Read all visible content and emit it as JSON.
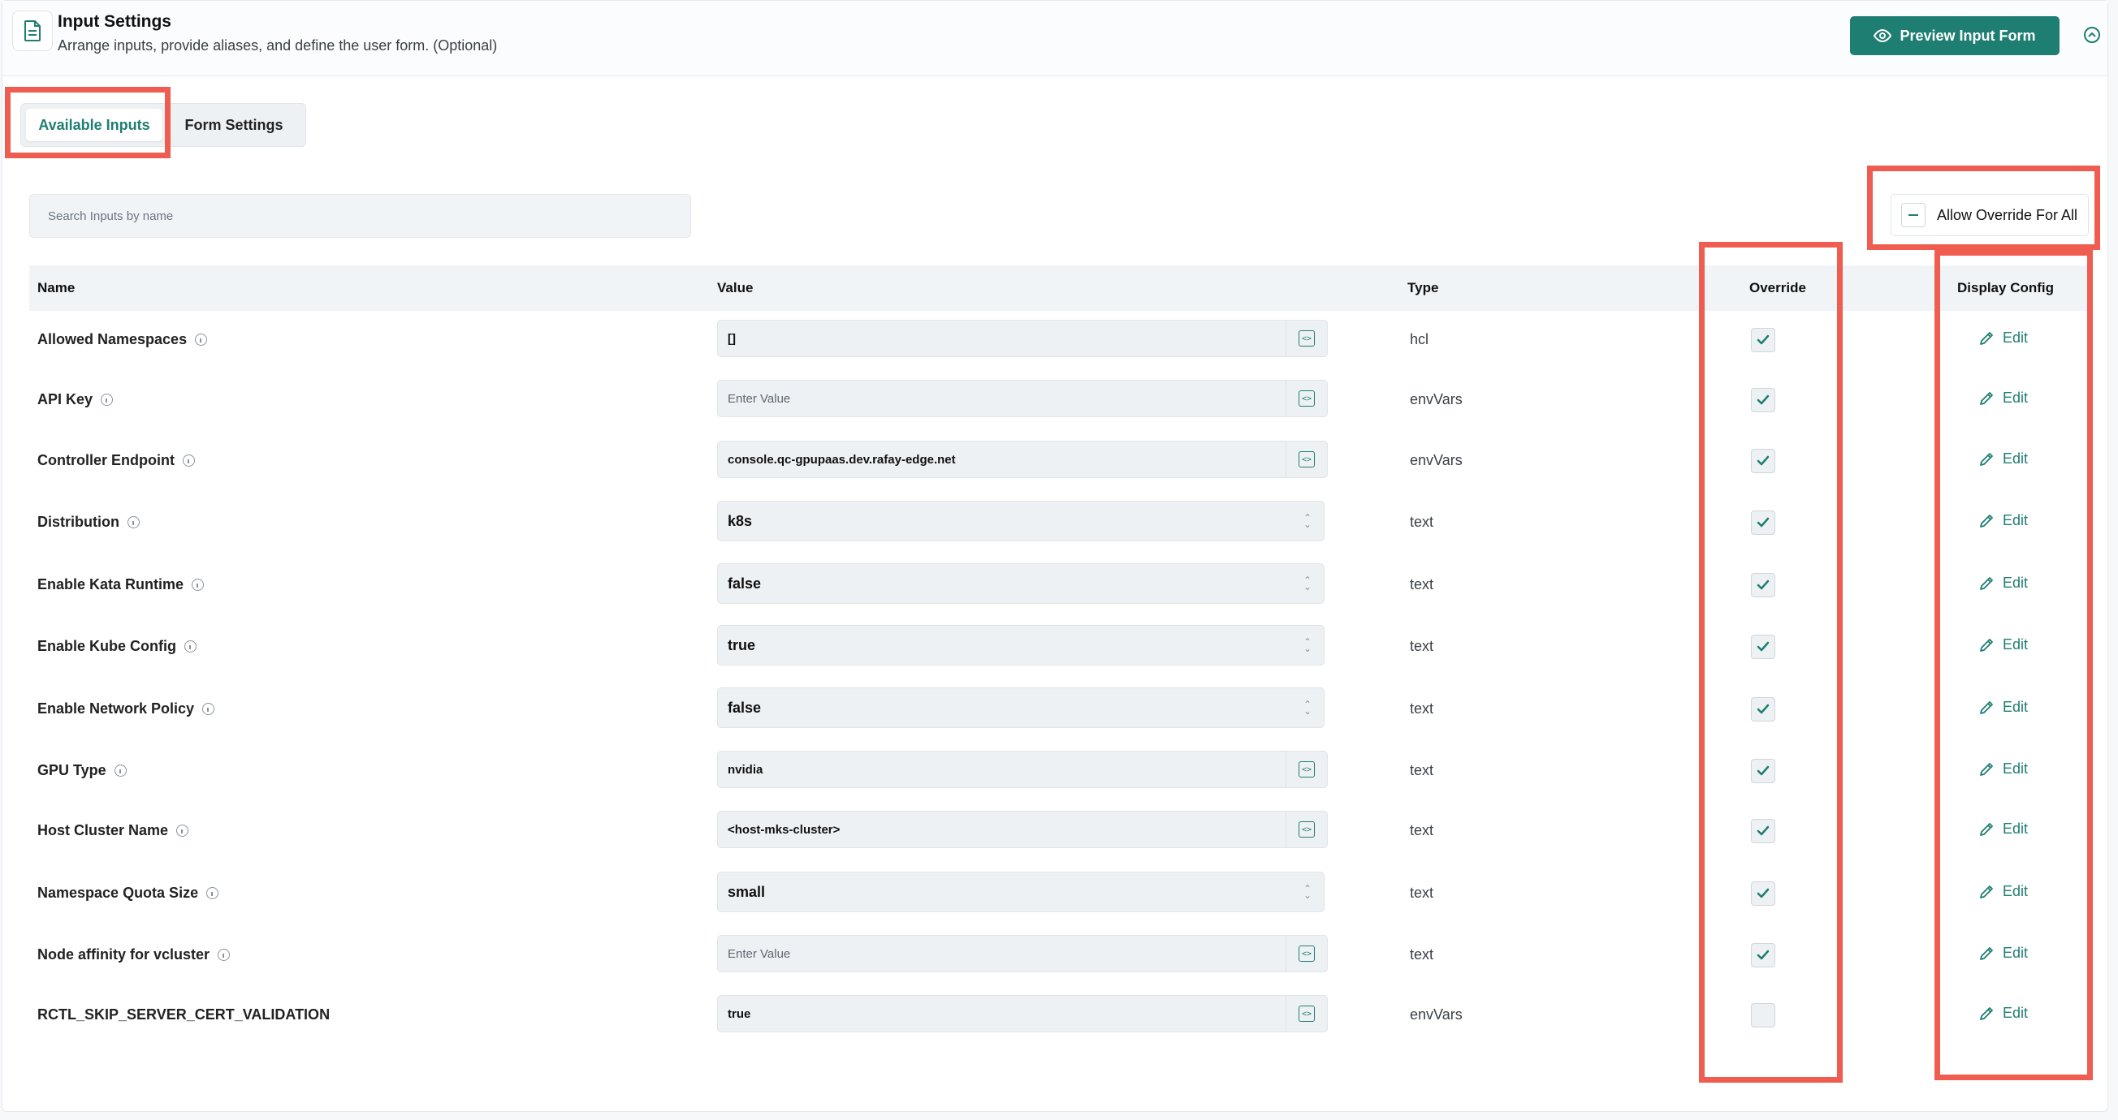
{
  "header": {
    "title": "Input Settings",
    "subtitle": "Arrange inputs, provide aliases, and define the user form. (Optional)",
    "preview_label": "Preview Input Form"
  },
  "tabs": [
    {
      "label": "Available Inputs",
      "active": true
    },
    {
      "label": "Form Settings",
      "active": false
    }
  ],
  "search": {
    "placeholder": "Search Inputs by name"
  },
  "override_all_label": "Allow Override For All",
  "table": {
    "headers": {
      "name": "Name",
      "value": "Value",
      "type": "Type",
      "override": "Override",
      "display": "Display Config"
    },
    "edit_label": "Edit",
    "rows": [
      {
        "name": "Allowed Namespaces",
        "info": true,
        "value": "[]",
        "placeholder": false,
        "control": "code",
        "type": "hcl",
        "override": true
      },
      {
        "name": "API Key",
        "info": true,
        "value": "Enter Value",
        "placeholder": true,
        "control": "code",
        "type": "envVars",
        "override": true
      },
      {
        "name": "Controller Endpoint",
        "info": true,
        "value": "console.qc-gpupaas.dev.rafay-edge.net",
        "placeholder": false,
        "control": "code",
        "type": "envVars",
        "override": true
      },
      {
        "name": "Distribution",
        "info": true,
        "value": "k8s",
        "placeholder": false,
        "control": "select",
        "type": "text",
        "override": true
      },
      {
        "name": "Enable Kata Runtime",
        "info": true,
        "value": "false",
        "placeholder": false,
        "control": "select",
        "type": "text",
        "override": true
      },
      {
        "name": "Enable Kube Config",
        "info": true,
        "value": "true",
        "placeholder": false,
        "control": "select",
        "type": "text",
        "override": true
      },
      {
        "name": "Enable Network Policy",
        "info": true,
        "value": "false",
        "placeholder": false,
        "control": "select",
        "type": "text",
        "override": true
      },
      {
        "name": "GPU Type",
        "info": true,
        "value": "nvidia",
        "placeholder": false,
        "control": "code",
        "type": "text",
        "override": true
      },
      {
        "name": "Host Cluster Name",
        "info": true,
        "value": "<host-mks-cluster>",
        "placeholder": false,
        "control": "code",
        "type": "text",
        "override": true
      },
      {
        "name": "Namespace Quota Size",
        "info": true,
        "value": "small",
        "placeholder": false,
        "control": "select",
        "type": "text",
        "override": true
      },
      {
        "name": "Node affinity for vcluster",
        "info": true,
        "value": "Enter Value",
        "placeholder": true,
        "control": "code",
        "type": "text",
        "override": true
      },
      {
        "name": "RCTL_SKIP_SERVER_CERT_VALIDATION",
        "info": false,
        "value": "true",
        "placeholder": false,
        "control": "code",
        "type": "envVars",
        "override": false
      }
    ]
  },
  "colors": {
    "accent": "#1e7e72",
    "highlight": "#ee5d50"
  }
}
